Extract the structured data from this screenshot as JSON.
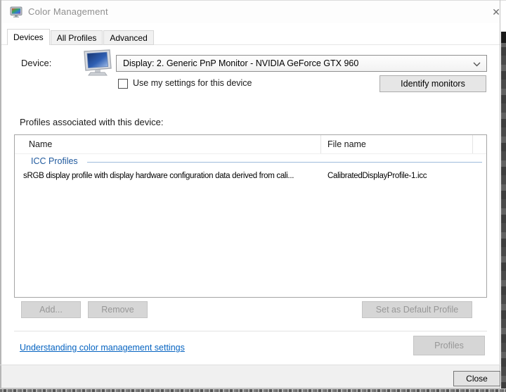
{
  "window": {
    "title": "Color Management",
    "close_glyph": "✕"
  },
  "tabs": [
    {
      "label": "Devices",
      "active": true
    },
    {
      "label": "All Profiles",
      "active": false
    },
    {
      "label": "Advanced",
      "active": false
    }
  ],
  "device_section": {
    "label": "Device:",
    "dropdown_value": "Display: 2. Generic PnP Monitor - NVIDIA GeForce GTX 960",
    "checkbox_label": "Use my settings for this device",
    "checkbox_checked": false,
    "identify_button_label": "Identify monitors"
  },
  "profiles_section": {
    "label": "Profiles associated with this device:",
    "columns": [
      "Name",
      "File name"
    ],
    "group_header": "ICC Profiles",
    "rows": [
      {
        "name": "sRGB display profile with display hardware configuration data derived from cali...",
        "file": "CalibratedDisplayProfile-1.icc"
      }
    ],
    "add_button_label": "Add...",
    "remove_button_label": "Remove",
    "set_default_button_label": "Set as Default Profile"
  },
  "footer": {
    "help_link_label": "Understanding color management settings",
    "profiles_button_label": "Profiles",
    "close_button_label": "Close"
  },
  "colors": {
    "link_blue": "#0563c1",
    "icc_group_blue": "#215a9e",
    "group_line_blue": "#9fbcdc",
    "footer_gray": "#f0f0f0",
    "disabled_button_gray": "#d6d6d6"
  }
}
